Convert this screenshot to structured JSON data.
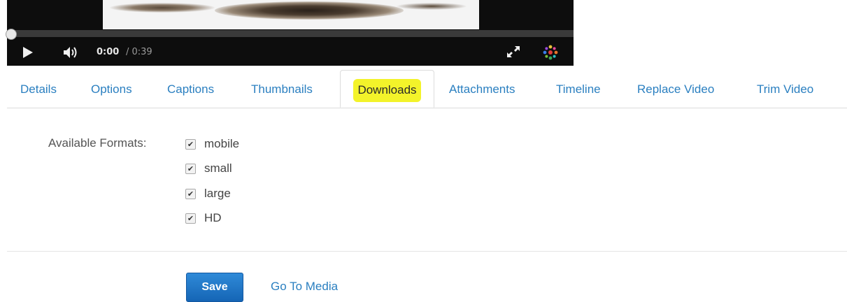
{
  "player": {
    "time_current": "0:00",
    "time_total": "/ 0:39",
    "progress": 0,
    "icons": {
      "play": "play-icon",
      "volume": "volume-icon",
      "fullscreen": "fullscreen-icon",
      "brand": "brand-logo-icon"
    }
  },
  "tabs": [
    {
      "label": "Details"
    },
    {
      "label": "Options"
    },
    {
      "label": "Captions"
    },
    {
      "label": "Thumbnails"
    },
    {
      "label": "Downloads",
      "active": true
    },
    {
      "label": "Attachments"
    },
    {
      "label": "Timeline"
    },
    {
      "label": "Replace Video"
    },
    {
      "label": "Trim Video"
    }
  ],
  "downloads": {
    "formats_label": "Available Formats:",
    "formats": [
      {
        "label": "mobile",
        "checked": true
      },
      {
        "label": "small",
        "checked": true
      },
      {
        "label": "large",
        "checked": true
      },
      {
        "label": "HD",
        "checked": true
      }
    ]
  },
  "actions": {
    "save_label": "Save",
    "go_to_media_label": "Go To Media"
  },
  "colors": {
    "link": "#2a7fc0",
    "highlight": "#f3f32a",
    "primary_button": "#1e73c4"
  }
}
